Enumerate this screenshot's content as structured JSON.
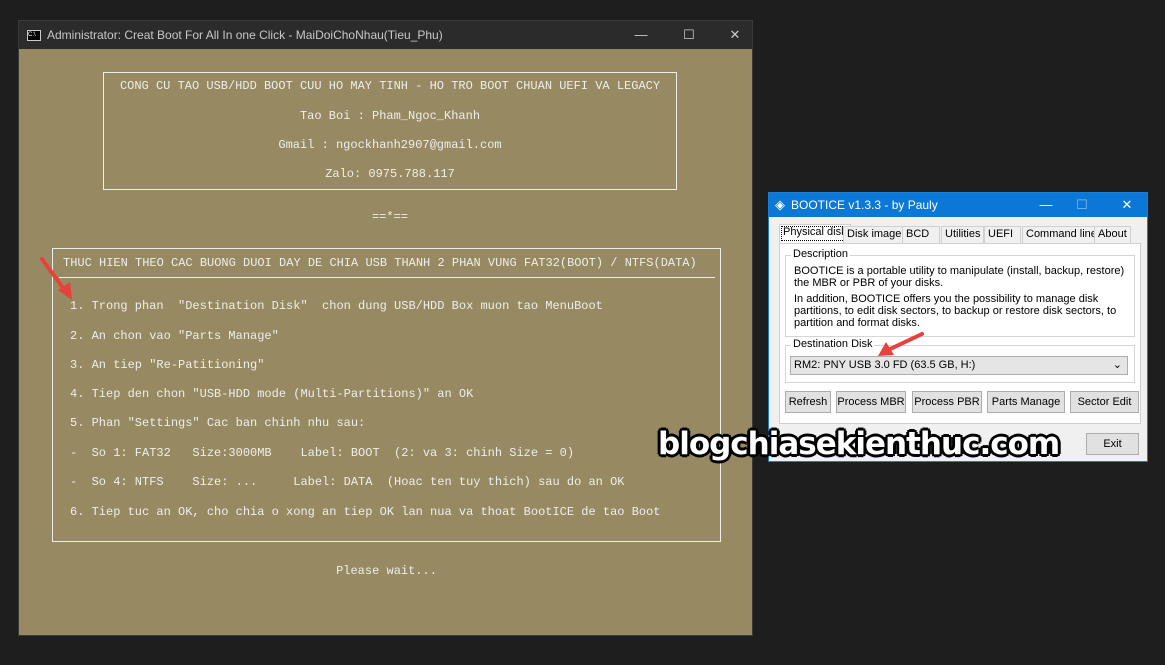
{
  "console": {
    "title": "Administrator:  Creat Boot For All  In one Click - MaiDoiChoNhau(Tieu_Phu)",
    "header_lines": [
      "CONG CU TAO USB/HDD BOOT CUU HO MAY TINH - HO TRO BOOT CHUAN UEFI VA LEGACY",
      "Tao Boi : Pham_Ngoc_Khanh",
      "Gmail : ngockhanh2907@gmail.com",
      "Zalo: 0975.788.117"
    ],
    "separator": "==*==",
    "steps_heading": "THUC HIEN THEO CAC BUONG DUOI DAY DE CHIA USB THANH 2 PHAN VUNG FAT32(BOOT) / NTFS(DATA)",
    "steps": [
      "1. Trong phan  \"Destination Disk\"  chon dung USB/HDD Box muon tao MenuBoot",
      "2. An chon vao \"Parts Manage\"",
      "3. An tiep \"Re-Patitioning\"",
      "4. Tiep den chon \"USB-HDD mode (Multi-Partitions)\" an OK",
      "5. Phan \"Settings\" Cac ban chinh nhu sau:",
      "-  So 1: FAT32   Size:3000MB    Label: BOOT  (2: va 3: chinh Size = 0)",
      "-  So 4: NTFS    Size: ...     Label: DATA  (Hoac ten tuy thich) sau do an OK",
      "6. Tiep tuc an OK, cho chia o xong an tiep OK lan nua va thoat BootICE de tao Boot"
    ],
    "status": "Please wait..."
  },
  "bootice": {
    "title": "BOOTICE v1.3.3 - by Pauly",
    "tabs": [
      "Physical disk",
      "Disk  image",
      "BCD",
      "Utilities",
      "UEFI",
      "Command line",
      "About"
    ],
    "active_tab": "Physical disk",
    "description_label": "Description",
    "description_p1": "BOOTICE is a portable utility to manipulate (install, backup, restore) the MBR or PBR of your disks.",
    "description_p2": "In addition, BOOTICE offers you the possibility to manage disk partitions, to edit disk sectors, to backup or restore disk sectors, to partition and format disks.",
    "destination_label": "Destination Disk",
    "destination_value": "RM2: PNY USB 3.0 FD (63.5 GB, H:)",
    "buttons": [
      "Refresh",
      "Process MBR",
      "Process PBR",
      "Parts Manage",
      "Sector Edit"
    ],
    "exit": "Exit"
  },
  "watermark": "blogchiasekienthuc.com",
  "colors": {
    "console_bg": "#978962",
    "titlebar_blue": "#0b78d7",
    "arrow": "#e8413c"
  }
}
